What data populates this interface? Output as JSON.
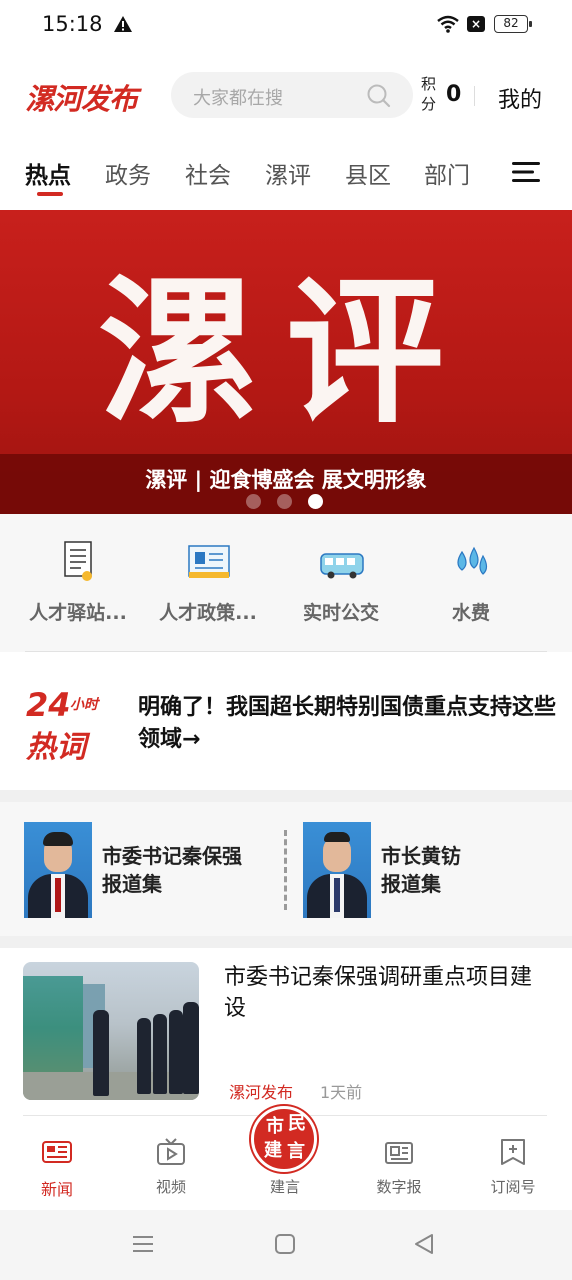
{
  "status_bar": {
    "time": "15:18",
    "battery": "82"
  },
  "header": {
    "logo": "漯河发布",
    "search_placeholder": "大家都在搜",
    "points_label": "积分",
    "points_value": "0",
    "mine_label": "我的"
  },
  "tabs": [
    {
      "label": "热点",
      "active": true
    },
    {
      "label": "政务"
    },
    {
      "label": "社会"
    },
    {
      "label": "漯评"
    },
    {
      "label": "县区"
    },
    {
      "label": "部门"
    }
  ],
  "banner": {
    "big_text": "漯评",
    "caption": "漯评 | 迎食博盛会 展文明形象",
    "slides": 3,
    "active_slide": 3
  },
  "services": [
    {
      "label": "人才驿站...",
      "icon": "document-icon"
    },
    {
      "label": "人才政策...",
      "icon": "id-card-icon"
    },
    {
      "label": "实时公交",
      "icon": "bus-icon"
    },
    {
      "label": "水费",
      "icon": "water-drops-icon"
    }
  ],
  "hot_words": {
    "logo_number": "24",
    "logo_hours": "小时",
    "logo_word": "热词",
    "headline": "明确了！我国超长期特别国债重点支持这些领域→"
  },
  "leaders": [
    {
      "name_line1": "市委书记秦保强",
      "name_line2": "报道集"
    },
    {
      "name_line1": "市长黄钫",
      "name_line2": "报道集"
    }
  ],
  "news": [
    {
      "title": "市委书记秦保强调研重点项目建设",
      "source": "漯河发布",
      "time": "1天前"
    }
  ],
  "bottom_nav": [
    {
      "label": "新闻",
      "icon": "news-icon",
      "active": true
    },
    {
      "label": "视频",
      "icon": "tv-icon"
    },
    {
      "label": "建言",
      "icon": "citizen-advice-stamp-icon",
      "stamp": [
        "市",
        "民",
        "建",
        "言"
      ]
    },
    {
      "label": "数字报",
      "icon": "newspaper-icon"
    },
    {
      "label": "订阅号",
      "icon": "subscribe-icon"
    }
  ],
  "colors": {
    "brand_red": "#d22a22",
    "banner_red": "#c8201c"
  }
}
